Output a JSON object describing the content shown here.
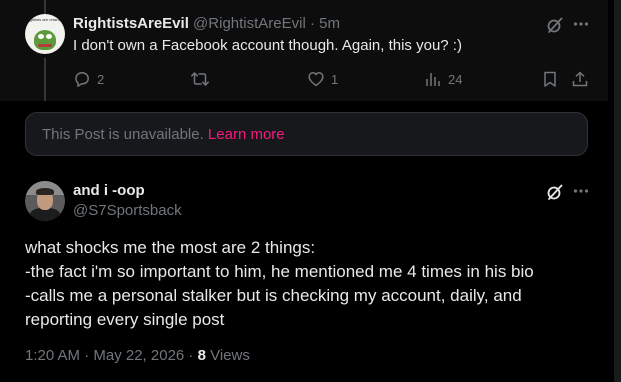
{
  "reply": {
    "display_name": "RightistsAreEvil",
    "handle": "@RightistAreEvil",
    "separator": "·",
    "time": "5m",
    "text": "I don't own a Facebook account though. Again, this you? :)",
    "avatar_caption": "Rightists are retarded",
    "actions": {
      "replies": "2",
      "reposts": "",
      "likes": "1",
      "views": "24"
    }
  },
  "unavailable": {
    "message": "This Post is unavailable.",
    "link": "Learn more"
  },
  "main_post": {
    "display_name": "and i -oop",
    "handle": "@S7Sportsback",
    "lines": [
      "what shocks me the most are 2 things:",
      "-the fact i'm so important to him, he mentioned me 4 times in his bio",
      "-calls me a personal stalker but is checking my account, daily, and",
      "reporting every single post"
    ],
    "timestamp": "1:20 AM · May 22, 2026",
    "meta_separator": " · ",
    "views_count": "8",
    "views_label": " Views"
  },
  "colors": {
    "background": "#000000",
    "text_primary": "#e7e9ea",
    "text_secondary": "#71767b",
    "link_accent": "#f91880",
    "border": "#2f3336"
  },
  "icons": {
    "grok": "grok-icon",
    "more": "more-icon",
    "reply": "reply-icon",
    "repost": "repost-icon",
    "like": "heart-icon",
    "views": "analytics-icon",
    "bookmark": "bookmark-icon",
    "share": "share-icon"
  }
}
